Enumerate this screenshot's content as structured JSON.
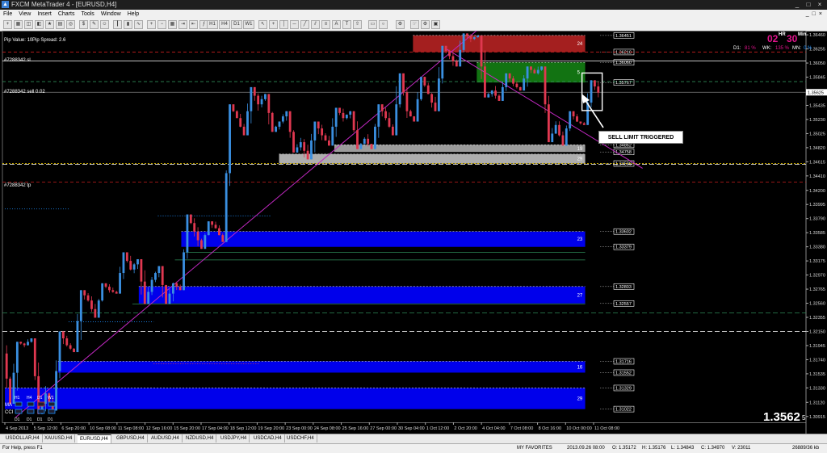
{
  "window": {
    "title": "FXCM MetaTrader 4 - [EURUSD,H4]",
    "controls": [
      "_",
      "□",
      "×"
    ]
  },
  "menu": {
    "items": [
      "File",
      "View",
      "Insert",
      "Charts",
      "Tools",
      "Window",
      "Help"
    ],
    "window_controls": [
      "_",
      "□",
      "×"
    ]
  },
  "toolbar": {
    "timeframes": [
      "H1",
      "H4",
      "D1",
      "W1"
    ]
  },
  "chart": {
    "pip_value": "Pip Value: 10",
    "pip_spread": "Pip Spread: 2.6",
    "countdown_hr": "02",
    "countdown_hr_label": "HR",
    "countdown_min": "30",
    "countdown_min_label": "Min",
    "stats": {
      "d1_label": "D1:",
      "d1_value": "81 %",
      "wk_label": "WK:",
      "wk_value": "135 %",
      "mn_label": "MN:",
      "mn_value": "0 %"
    },
    "order_sl": "#7288342 sl",
    "order_sell": "#7288342 sell 0.02",
    "order_tp": "#7288342 tp",
    "annotation": "SELL LIMIT TRIGGERED",
    "big_price": "1.3562",
    "big_price_suffix": "5",
    "bid_tag": "1.35625",
    "indicator_labels": [
      "MA",
      "CCI"
    ],
    "tf_labels": [
      "H1",
      "H4",
      "D1",
      "W1"
    ],
    "tf_sub": [
      "D1",
      "D1",
      "D1",
      "D1"
    ]
  },
  "zones": [
    {
      "name": "zone-red",
      "color": "#b22222",
      "top": 1.36451,
      "bottom": 1.3621,
      "start_day": 19.2,
      "end_day": 27.3,
      "label": "24"
    },
    {
      "name": "zone-green",
      "color": "#137d13",
      "top": 1.3606,
      "bottom": 1.35767,
      "start_day": 22.2,
      "end_day": 27.3,
      "label": "5"
    },
    {
      "name": "zone-gray-1",
      "color": "#a9a9a9",
      "top": 1.34862,
      "bottom": 1.34758,
      "start_day": 15.5,
      "end_day": 27.3,
      "label": "19"
    },
    {
      "name": "zone-gray-2",
      "color": "#bdbdbd",
      "top": 1.34727,
      "bottom": 1.3459,
      "start_day": 12.9,
      "end_day": 27.3,
      "label": "29"
    },
    {
      "name": "zone-blue-1",
      "color": "#0000ff",
      "top": 1.33602,
      "bottom": 1.33379,
      "start_day": 8.3,
      "end_day": 27.3,
      "label": "23"
    },
    {
      "name": "zone-blue-2",
      "color": "#0000ff",
      "top": 1.32803,
      "bottom": 1.32557,
      "start_day": 6.3,
      "end_day": 27.3,
      "label": "27"
    },
    {
      "name": "zone-blue-3",
      "color": "#0000ff",
      "top": 1.31716,
      "bottom": 1.31552,
      "start_day": 2.5,
      "end_day": 27.3,
      "label": "16"
    },
    {
      "name": "zone-blue-4",
      "color": "#0000ff",
      "top": 1.31329,
      "bottom": 1.31022,
      "start_day": 0,
      "end_day": 27.3,
      "label": "29"
    }
  ],
  "price_tags": [
    "1.36451",
    "1.36210",
    "1.36060",
    "1.35767",
    "1.34862",
    "1.34758",
    "1.34590",
    "1.33602",
    "1.33379",
    "1.32803",
    "1.32557",
    "1.31716",
    "1.31552",
    "1.31329",
    "1.31022"
  ],
  "chart_data": {
    "type": "candlestick",
    "symbol": "EURUSD,H4",
    "y_ticks": [
      "1.36460",
      "1.36255",
      "1.36050",
      "1.35845",
      "1.35635",
      "1.35435",
      "1.35230",
      "1.35025",
      "1.34820",
      "1.34615",
      "1.34410",
      "1.34200",
      "1.33995",
      "1.33790",
      "1.33585",
      "1.33380",
      "1.33175",
      "1.32970",
      "1.32765",
      "1.32560",
      "1.32355",
      "1.32150",
      "1.31945",
      "1.31740",
      "1.31535",
      "1.31330",
      "1.31120",
      "1.30915"
    ],
    "x_ticks": [
      "4 Sep 2013",
      "5 Sep 12:00",
      "6 Sep 20:00",
      "10 Sep 08:00",
      "11 Sep 08:00",
      "12 Sep 16:00",
      "15 Sep 20:00",
      "17 Sep 04:00",
      "18 Sep 12:00",
      "19 Sep 20:00",
      "23 Sep 00:00",
      "24 Sep 08:00",
      "25 Sep 16:00",
      "27 Sep 00:00",
      "30 Sep 04:00",
      "1 Oct 12:00",
      "2 Oct 20:00",
      "4 Oct 04:00",
      "7 Oct 08:00",
      "8 Oct 16:00",
      "10 Oct 00:00",
      "11 Oct 08:00"
    ],
    "ylim": [
      1.3083,
      1.3652
    ],
    "current_price": 1.35625,
    "levels": {
      "sl": 1.3621,
      "sell": 1.3578,
      "tp": 1.3432
    },
    "trendline_up": {
      "from_day": 0.5,
      "from_price": 1.309,
      "to_day": 22.5,
      "to_price": 1.366
    },
    "trendline_down": {
      "from_day": 20.8,
      "from_price": 1.3625,
      "to_day": 30.0,
      "to_price": 1.3452
    },
    "days": [
      {
        "day": "4 Sep",
        "open": 1.3183,
        "close": 1.3195,
        "high": 1.32,
        "low": 1.311
      },
      {
        "day": "5 Sep",
        "open": 1.3195,
        "close": 1.3125,
        "high": 1.3205,
        "low": 1.3095
      },
      {
        "day": "6 Sep",
        "open": 1.3125,
        "close": 1.3195,
        "high": 1.3215,
        "low": 1.31
      },
      {
        "day": "9 Sep",
        "open": 1.3195,
        "close": 1.326,
        "high": 1.3275,
        "low": 1.3185
      },
      {
        "day": "10 Sep",
        "open": 1.326,
        "close": 1.3275,
        "high": 1.3285,
        "low": 1.3235
      },
      {
        "day": "11 Sep",
        "open": 1.3275,
        "close": 1.3305,
        "high": 1.333,
        "low": 1.327
      },
      {
        "day": "12 Sep",
        "open": 1.3305,
        "close": 1.329,
        "high": 1.332,
        "low": 1.3255
      },
      {
        "day": "13 Sep",
        "open": 1.329,
        "close": 1.3285,
        "high": 1.331,
        "low": 1.3255
      },
      {
        "day": "16 Sep",
        "open": 1.3285,
        "close": 1.336,
        "high": 1.3385,
        "low": 1.3275
      },
      {
        "day": "17 Sep",
        "open": 1.336,
        "close": 1.3365,
        "high": 1.3375,
        "low": 1.3335
      },
      {
        "day": "18 Sep",
        "open": 1.3365,
        "close": 1.3525,
        "high": 1.3545,
        "low": 1.3345
      },
      {
        "day": "19 Sep",
        "open": 1.3525,
        "close": 1.3545,
        "high": 1.357,
        "low": 1.35
      },
      {
        "day": "20 Sep",
        "open": 1.3545,
        "close": 1.352,
        "high": 1.356,
        "low": 1.3505
      },
      {
        "day": "23 Sep",
        "open": 1.352,
        "close": 1.349,
        "high": 1.3535,
        "low": 1.3475
      },
      {
        "day": "24 Sep",
        "open": 1.349,
        "close": 1.35,
        "high": 1.352,
        "low": 1.3465
      },
      {
        "day": "25 Sep",
        "open": 1.35,
        "close": 1.3525,
        "high": 1.354,
        "low": 1.3485
      },
      {
        "day": "26 Sep",
        "open": 1.3525,
        "close": 1.3495,
        "high": 1.3535,
        "low": 1.348
      },
      {
        "day": "27 Sep",
        "open": 1.3495,
        "close": 1.3525,
        "high": 1.3545,
        "low": 1.348
      },
      {
        "day": "30 Sep",
        "open": 1.3525,
        "close": 1.3535,
        "high": 1.359,
        "low": 1.35
      },
      {
        "day": "1 Oct",
        "open": 1.3535,
        "close": 1.356,
        "high": 1.3585,
        "low": 1.352
      },
      {
        "day": "2 Oct",
        "open": 1.356,
        "close": 1.3615,
        "high": 1.363,
        "low": 1.3535
      },
      {
        "day": "3 Oct",
        "open": 1.3615,
        "close": 1.364,
        "high": 1.3648,
        "low": 1.36
      },
      {
        "day": "4 Oct",
        "open": 1.364,
        "close": 1.3565,
        "high": 1.3645,
        "low": 1.3555
      },
      {
        "day": "7 Oct",
        "open": 1.3565,
        "close": 1.3575,
        "high": 1.359,
        "low": 1.355
      },
      {
        "day": "8 Oct",
        "open": 1.3575,
        "close": 1.359,
        "high": 1.36,
        "low": 1.3565
      },
      {
        "day": "9 Oct",
        "open": 1.359,
        "close": 1.3515,
        "high": 1.36,
        "low": 1.349
      },
      {
        "day": "10 Oct",
        "open": 1.3515,
        "close": 1.352,
        "high": 1.3535,
        "low": 1.3485
      },
      {
        "day": "11 Oct",
        "open": 1.352,
        "close": 1.3562,
        "high": 1.358,
        "low": 1.3515
      }
    ]
  },
  "symbol_tabs": [
    "USDOLLAR,H4",
    "XAUUSD,H4",
    "EURUSD,H4",
    "GBPUSD,H4",
    "AUDUSD,H4",
    "NZDUSD,H4",
    "USDJPY,H4",
    "USDCAD,H4",
    "USDCHF,H4"
  ],
  "active_tab": 2,
  "status": {
    "help": "For Help, press F1",
    "profile": "MY FAVORITES",
    "datetime": "2013.09.26 08:00",
    "open": "O: 1.35172",
    "high": "H: 1.35176",
    "low": "L: 1.34843",
    "close": "C: 1.34970",
    "volume": "V: 23011",
    "traffic": "26889/36 kb"
  }
}
